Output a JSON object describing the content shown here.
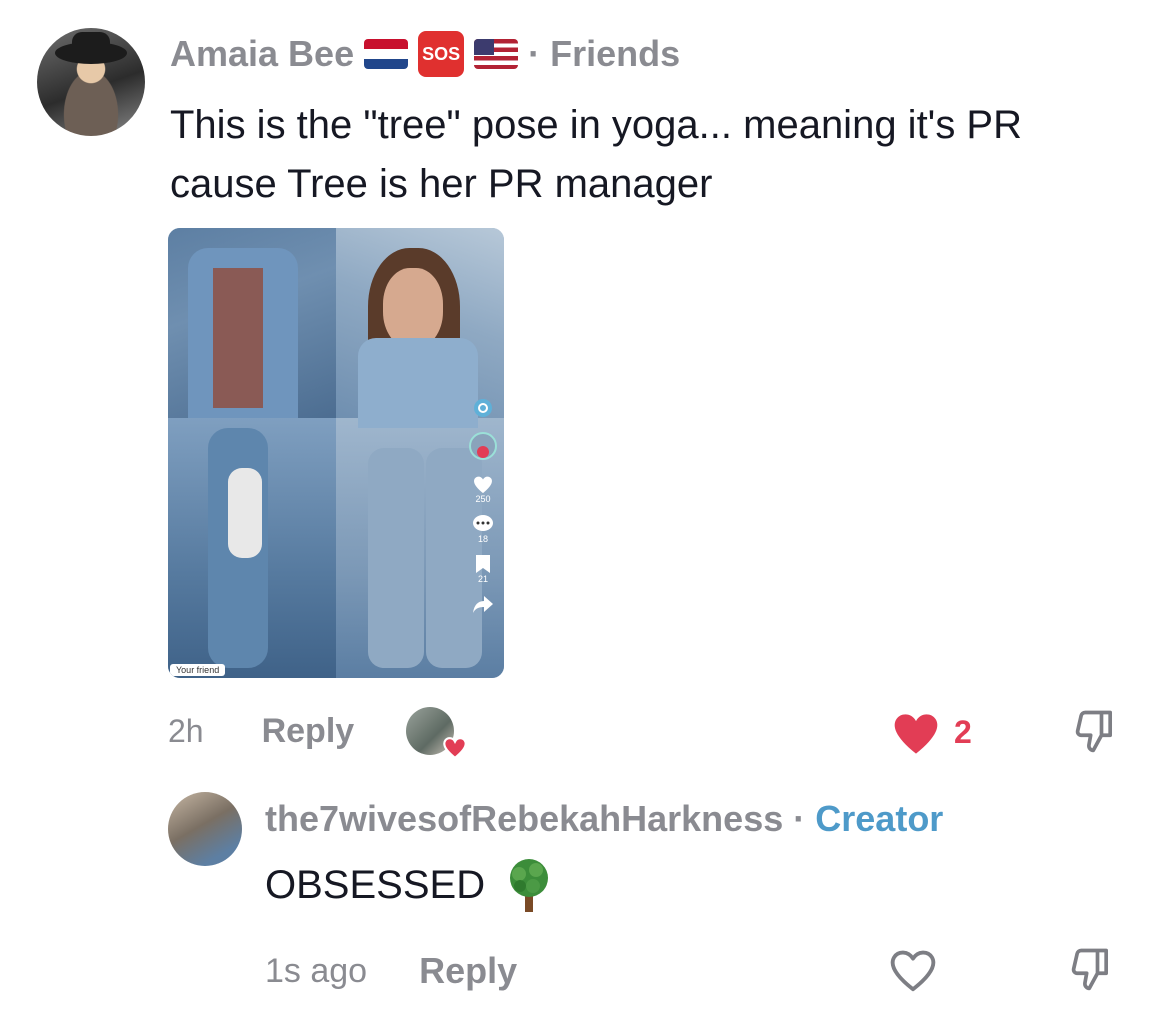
{
  "comment": {
    "username": "Amaia Bee",
    "badges": [
      "flag-netherlands",
      "sos",
      "flag-usa"
    ],
    "sos_label": "SOS",
    "separator": "·",
    "relation": "Friends",
    "text": "This is the \"tree\" pose in yoga... meaning it's PR cause Tree is her PR manager",
    "attachment": {
      "overlay_label": "Your friend",
      "side_counts": [
        "250",
        "18",
        "21"
      ]
    },
    "time": "2h",
    "reply_label": "Reply",
    "like_count": "2",
    "liked": true
  },
  "reply": {
    "username": "the7wivesofRebekahHarkness",
    "separator": "·",
    "role": "Creator",
    "text": "OBSESSED",
    "emoji": "tree-emoji",
    "time": "1s ago",
    "reply_label": "Reply"
  },
  "colors": {
    "muted": "#8a8b91",
    "like_red": "#e23d55",
    "creator_blue": "#4e9ac9",
    "text": "#161823"
  }
}
